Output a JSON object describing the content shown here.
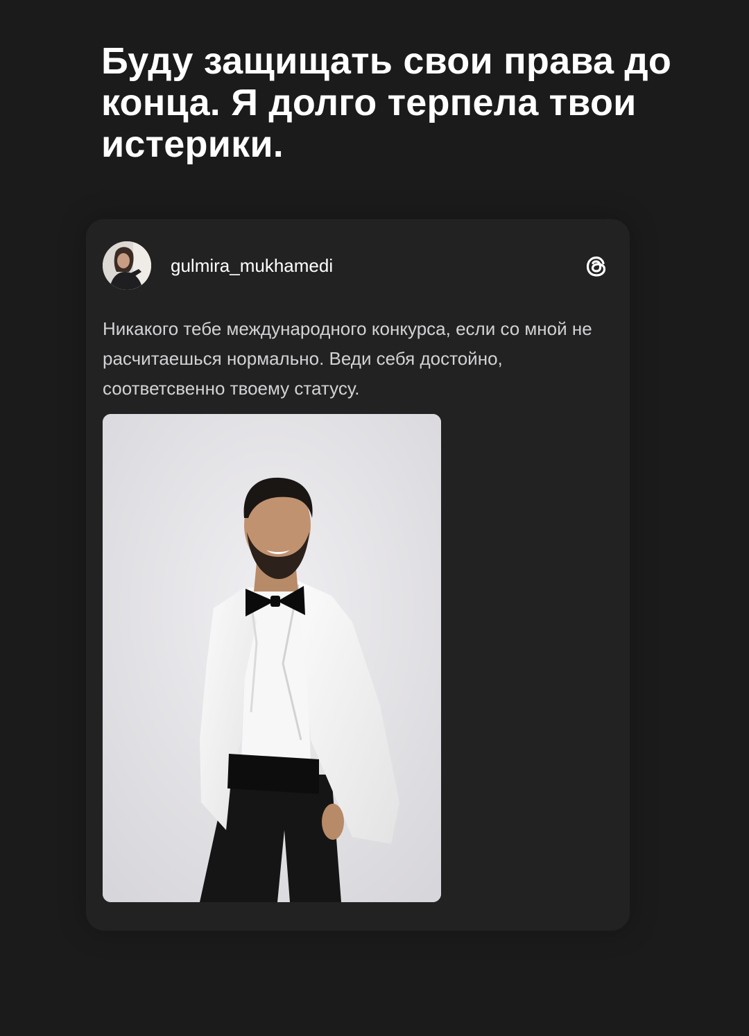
{
  "headline": "Буду защищать свои права до конца. Я долго терпела твои истерики.",
  "post": {
    "author": {
      "username": "gulmira_mukhamedi",
      "avatar_icon": "avatar-photo"
    },
    "platform_icon": "threads-logo-icon",
    "text": "Никакого тебе международного конкурса, если со мной не расчитаешься нормально. Веди себя достойно, соответсвенно твоему статусу.",
    "image": "photo-man-in-white-tuxedo"
  },
  "colors": {
    "background": "#1b1b1c",
    "card": "#222223",
    "headline_text": "#ffffff",
    "post_text": "#d3d3d6"
  }
}
